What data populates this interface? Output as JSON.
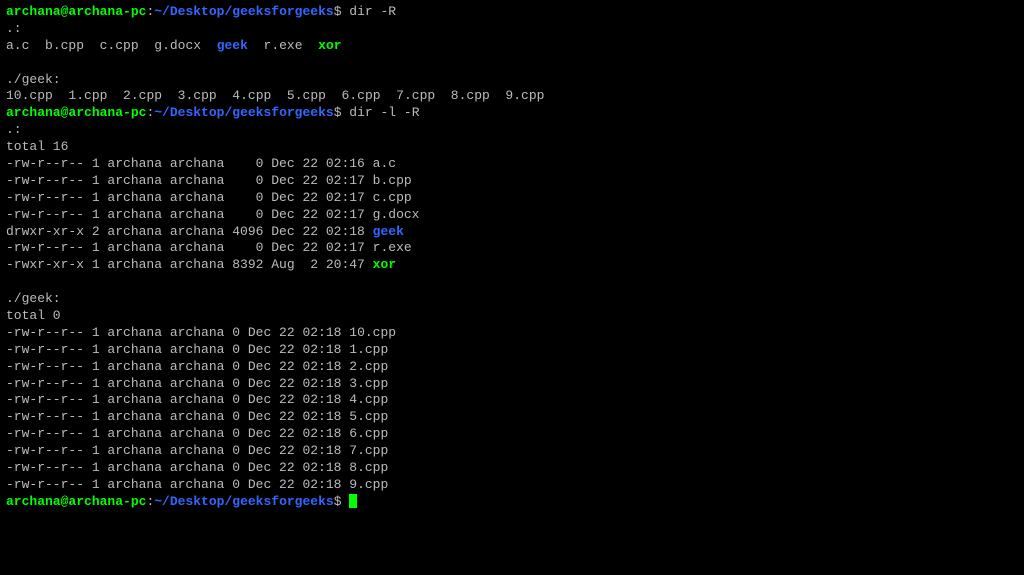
{
  "prompt": {
    "user": "archana",
    "at": "@",
    "host": "archana-pc",
    "colon": ":",
    "path": "~/Desktop/geeksforgeeks",
    "dollar": "$"
  },
  "blocks": [
    {
      "command": " dir -R",
      "output": {
        "dir_header": ".:",
        "files_short": [
          {
            "name": "a.c",
            "type": "file"
          },
          {
            "name": "b.cpp",
            "type": "file"
          },
          {
            "name": "c.cpp",
            "type": "file"
          },
          {
            "name": "g.docx",
            "type": "file"
          },
          {
            "name": "geek",
            "type": "dir"
          },
          {
            "name": "r.exe",
            "type": "file"
          },
          {
            "name": "xor",
            "type": "exe"
          }
        ],
        "sub_header": "./geek:",
        "sub_files": [
          "10.cpp",
          "1.cpp",
          "2.cpp",
          "3.cpp",
          "4.cpp",
          "5.cpp",
          "6.cpp",
          "7.cpp",
          "8.cpp",
          "9.cpp"
        ]
      }
    },
    {
      "command": " dir -l -R",
      "output": {
        "dir_header": ".:",
        "total": "total 16",
        "rows": [
          {
            "perm": "-rw-r--r--",
            "links": "1",
            "owner": "archana",
            "group": "archana",
            "size": "   0",
            "date": "Dec 22 02:16",
            "name": "a.c",
            "type": "file"
          },
          {
            "perm": "-rw-r--r--",
            "links": "1",
            "owner": "archana",
            "group": "archana",
            "size": "   0",
            "date": "Dec 22 02:17",
            "name": "b.cpp",
            "type": "file"
          },
          {
            "perm": "-rw-r--r--",
            "links": "1",
            "owner": "archana",
            "group": "archana",
            "size": "   0",
            "date": "Dec 22 02:17",
            "name": "c.cpp",
            "type": "file"
          },
          {
            "perm": "-rw-r--r--",
            "links": "1",
            "owner": "archana",
            "group": "archana",
            "size": "   0",
            "date": "Dec 22 02:17",
            "name": "g.docx",
            "type": "file"
          },
          {
            "perm": "drwxr-xr-x",
            "links": "2",
            "owner": "archana",
            "group": "archana",
            "size": "4096",
            "date": "Dec 22 02:18",
            "name": "geek",
            "type": "dir"
          },
          {
            "perm": "-rw-r--r--",
            "links": "1",
            "owner": "archana",
            "group": "archana",
            "size": "   0",
            "date": "Dec 22 02:17",
            "name": "r.exe",
            "type": "file"
          },
          {
            "perm": "-rwxr-xr-x",
            "links": "1",
            "owner": "archana",
            "group": "archana",
            "size": "8392",
            "date": "Aug  2 20:47",
            "name": "xor",
            "type": "exe"
          }
        ],
        "sub_header": "./geek:",
        "sub_total": "total 0",
        "sub_rows": [
          {
            "perm": "-rw-r--r--",
            "links": "1",
            "owner": "archana",
            "group": "archana",
            "size": "0",
            "date": "Dec 22 02:18",
            "name": "10.cpp"
          },
          {
            "perm": "-rw-r--r--",
            "links": "1",
            "owner": "archana",
            "group": "archana",
            "size": "0",
            "date": "Dec 22 02:18",
            "name": "1.cpp"
          },
          {
            "perm": "-rw-r--r--",
            "links": "1",
            "owner": "archana",
            "group": "archana",
            "size": "0",
            "date": "Dec 22 02:18",
            "name": "2.cpp"
          },
          {
            "perm": "-rw-r--r--",
            "links": "1",
            "owner": "archana",
            "group": "archana",
            "size": "0",
            "date": "Dec 22 02:18",
            "name": "3.cpp"
          },
          {
            "perm": "-rw-r--r--",
            "links": "1",
            "owner": "archana",
            "group": "archana",
            "size": "0",
            "date": "Dec 22 02:18",
            "name": "4.cpp"
          },
          {
            "perm": "-rw-r--r--",
            "links": "1",
            "owner": "archana",
            "group": "archana",
            "size": "0",
            "date": "Dec 22 02:18",
            "name": "5.cpp"
          },
          {
            "perm": "-rw-r--r--",
            "links": "1",
            "owner": "archana",
            "group": "archana",
            "size": "0",
            "date": "Dec 22 02:18",
            "name": "6.cpp"
          },
          {
            "perm": "-rw-r--r--",
            "links": "1",
            "owner": "archana",
            "group": "archana",
            "size": "0",
            "date": "Dec 22 02:18",
            "name": "7.cpp"
          },
          {
            "perm": "-rw-r--r--",
            "links": "1",
            "owner": "archana",
            "group": "archana",
            "size": "0",
            "date": "Dec 22 02:18",
            "name": "8.cpp"
          },
          {
            "perm": "-rw-r--r--",
            "links": "1",
            "owner": "archana",
            "group": "archana",
            "size": "0",
            "date": "Dec 22 02:18",
            "name": "9.cpp"
          }
        ]
      }
    }
  ]
}
